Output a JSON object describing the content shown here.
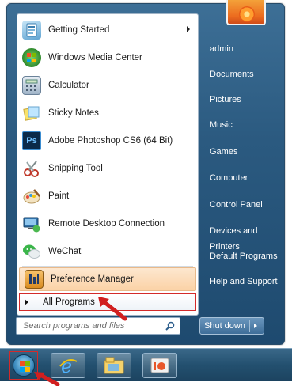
{
  "start_menu": {
    "programs": [
      {
        "label": "Getting Started",
        "icon": "getting-started-icon",
        "has_submenu": true
      },
      {
        "label": "Windows Media Center",
        "icon": "windows-media-center-icon"
      },
      {
        "label": "Calculator",
        "icon": "calculator-icon"
      },
      {
        "label": "Sticky Notes",
        "icon": "sticky-notes-icon"
      },
      {
        "label": "Adobe Photoshop CS6 (64 Bit)",
        "icon": "photoshop-icon",
        "icon_text": "Ps"
      },
      {
        "label": "Snipping Tool",
        "icon": "snipping-tool-icon"
      },
      {
        "label": "Paint",
        "icon": "paint-icon"
      },
      {
        "label": "Remote Desktop Connection",
        "icon": "remote-desktop-icon"
      },
      {
        "label": "WeChat",
        "icon": "wechat-icon"
      },
      {
        "label": "Preference Manager",
        "icon": "preference-manager-icon",
        "highlighted": true
      }
    ],
    "all_programs_label": "All Programs",
    "search_placeholder": "Search programs and files",
    "right_items": [
      {
        "label": "admin"
      },
      {
        "label": "Documents"
      },
      {
        "label": "Pictures"
      },
      {
        "label": "Music"
      },
      {
        "label": "Games"
      },
      {
        "label": "Computer"
      },
      {
        "label": "Control Panel"
      },
      {
        "label": "Devices and Printers"
      },
      {
        "label": "Default Programs"
      },
      {
        "label": "Help and Support"
      }
    ],
    "shutdown_label": "Shut down"
  },
  "taskbar": {
    "items": [
      {
        "name": "internet-explorer-icon"
      },
      {
        "name": "windows-explorer-icon"
      },
      {
        "name": "media-player-icon"
      }
    ]
  },
  "colors": {
    "highlight_border": "#d32a2a",
    "menu_blue": "#2b5a80",
    "preference_highlight": "#fbd2a6"
  }
}
